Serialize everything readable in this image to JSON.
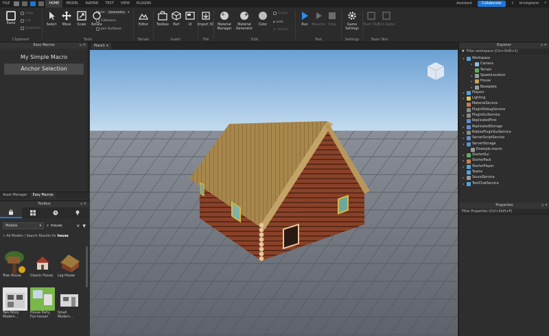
{
  "menubar": {
    "file": "FILE",
    "tabs": [
      "HOME",
      "MODEL",
      "AVATAR",
      "TEST",
      "VIEW",
      "PLUGINS"
    ],
    "active_tab": "HOME",
    "assistant": "Assistant",
    "collaborate": "Collaborate",
    "username": "brinkgheim"
  },
  "ribbon": {
    "clipboard": {
      "label": "Clipboard",
      "paste": "Paste",
      "copy": "Copy",
      "cut": "Cut",
      "duplicate": "Duplicate"
    },
    "tools": {
      "label": "Tools",
      "select": "Select",
      "move": "Move",
      "scale": "Scale",
      "rotate": "Rotate",
      "mode_label": "Mode:",
      "mode_value": "Geometric",
      "collisions": "Collisions",
      "join_surfaces": "Join Surfaces"
    },
    "terrain": {
      "label": "Terrain",
      "editor": "Editor"
    },
    "insert": {
      "label": "Insert",
      "toolbox": "Toolbox",
      "part": "Part",
      "ui": "UI"
    },
    "file": {
      "label": "File",
      "import3d": "Import 3D"
    },
    "edit": {
      "label": "Edit",
      "material_manager": "Material Manager",
      "material_generator": "Material Generator",
      "color": "Color",
      "group": "Group",
      "lock": "Lock",
      "anchor": "Anchor"
    },
    "test": {
      "label": "Test",
      "run": "Run",
      "resume": "Resume",
      "stop": "Stop"
    },
    "settings": {
      "label": "Settings",
      "game_settings": "Game Settings"
    },
    "team_test": {
      "label": "Team Test",
      "team_test": "Team Test",
      "exit_game": "Exit Game"
    }
  },
  "left_panel": {
    "header": "Easy Macros",
    "macro_title": "My Simple Macro",
    "macro_button": "Anchor Selection",
    "tabs": [
      "Asset Manager",
      "Easy Macros"
    ]
  },
  "toolbox": {
    "header": "Toolbox",
    "category": "Models",
    "search_value": "house",
    "breadcrumb_prefix": "< All Models / Search Results for",
    "breadcrumb_query": "house",
    "results": [
      "Tree House",
      "Classic House",
      "Log House",
      "Two-Story Modern...",
      "House Party Fun house!",
      "Small Modern..."
    ]
  },
  "viewport": {
    "tab": "Place1"
  },
  "explorer": {
    "header": "Explorer",
    "filter": "Filter workspace (Ctrl+Shift+X)",
    "items": [
      {
        "label": "Workspace",
        "color": "#4fa3e0"
      },
      {
        "label": "Camera",
        "color": "#8fb9e0"
      },
      {
        "label": "Terrain",
        "color": "#5fae5f"
      },
      {
        "label": "SpawnLocation",
        "color": "#9a9a9a"
      },
      {
        "label": "House",
        "color": "#c7a25a"
      },
      {
        "label": "Baseplate",
        "color": "#9a9a9a"
      },
      {
        "label": "Players",
        "color": "#4fa3e0"
      },
      {
        "label": "Lighting",
        "color": "#e0c24f"
      },
      {
        "label": "MaterialService",
        "color": "#c77f4f"
      },
      {
        "label": "PluginDebugService",
        "color": "#8a8a8a"
      },
      {
        "label": "PluginGuiService",
        "color": "#8a8a8a"
      },
      {
        "label": "ReplicatedFirst",
        "color": "#5f8fd0"
      },
      {
        "label": "ReplicatedStorage",
        "color": "#5f8fd0"
      },
      {
        "label": "RobloxPluginGuiService",
        "color": "#8a8a8a"
      },
      {
        "label": "ServerScriptService",
        "color": "#5f8fd0"
      },
      {
        "label": "ServerStorage",
        "color": "#5f8fd0"
      },
      {
        "label": "Example.macro",
        "color": "#9a9a9a"
      },
      {
        "label": "StarterGui",
        "color": "#5fae5f"
      },
      {
        "label": "StarterPack",
        "color": "#c77f4f"
      },
      {
        "label": "StarterPlayer",
        "color": "#4fa3e0"
      },
      {
        "label": "Teams",
        "color": "#4fa3e0"
      },
      {
        "label": "SoundService",
        "color": "#9a9a9a"
      },
      {
        "label": "TextChatService",
        "color": "#4fa3e0"
      }
    ]
  },
  "properties": {
    "header": "Properties",
    "filter": "Filter Properties (Ctrl+Shift+P)"
  },
  "colors": {
    "accent": "#1a78d6",
    "panel": "#2e2e2e",
    "sky_top": "#6aa0d4",
    "sky_bottom": "#bcd9ee",
    "ground": "#6b7079"
  }
}
